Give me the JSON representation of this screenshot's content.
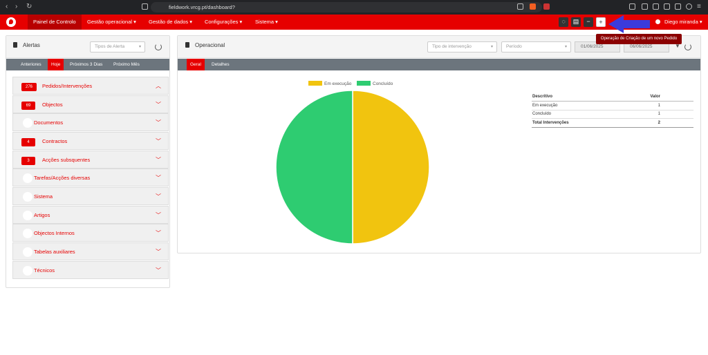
{
  "browser": {
    "url": "fieldwork.vrcg.pt/dashboard?"
  },
  "menu": {
    "items": [
      "Painel de Controlo",
      "Gestão operacional ▾",
      "Gestão de dados ▾",
      "Configurações ▾",
      "Sistema ▾"
    ],
    "user": "Diego miranda ▾",
    "tooltip": "Operação de Criação de um novo Pedido"
  },
  "alerts": {
    "title": "Alertas",
    "type_placeholder": "Tipos de Alerta",
    "tabs": [
      "Anteriores",
      "Hoje",
      "Próximos 3 Dias",
      "Próximo Mês"
    ],
    "active_tab": "Hoje",
    "items": [
      {
        "label": "Pedidos/Intervenções",
        "count": "276",
        "expanded": true
      },
      {
        "label": "Objectos",
        "count": "69"
      },
      {
        "label": "Documentos",
        "count": ""
      },
      {
        "label": "Contractos",
        "count": "4"
      },
      {
        "label": "Acções subsquentes",
        "count": "3"
      },
      {
        "label": "Tarefas/Acções diversas",
        "count": ""
      },
      {
        "label": "Sistema",
        "count": ""
      },
      {
        "label": "Artigos",
        "count": ""
      },
      {
        "label": "Objectos Internos",
        "count": ""
      },
      {
        "label": "Tabelas auxiliares",
        "count": ""
      },
      {
        "label": "Técnicos",
        "count": ""
      }
    ]
  },
  "operational": {
    "title": "Operacional",
    "intervention_type_placeholder": "Tipo de intervenção",
    "period_placeholder": "Período",
    "date_from": "01/06/2025",
    "date_to": "06/06/2025",
    "tabs": [
      "Geral",
      "Detalhes"
    ],
    "active_tab": "Geral",
    "table": {
      "headers": [
        "Descritivo",
        "Valor"
      ],
      "rows": [
        [
          "Em execução",
          "1"
        ],
        [
          "Concluído",
          "1"
        ]
      ],
      "total": [
        "Total Intervenções",
        "2"
      ]
    }
  },
  "chart_data": {
    "type": "pie",
    "categories": [
      "Em execução",
      "Concluído"
    ],
    "values": [
      1,
      1
    ],
    "colors": [
      "#f1c40f",
      "#2ecc71"
    ],
    "legend": "top"
  },
  "colors": {
    "brand": "#e60000",
    "tab_bar": "#6c757d"
  }
}
